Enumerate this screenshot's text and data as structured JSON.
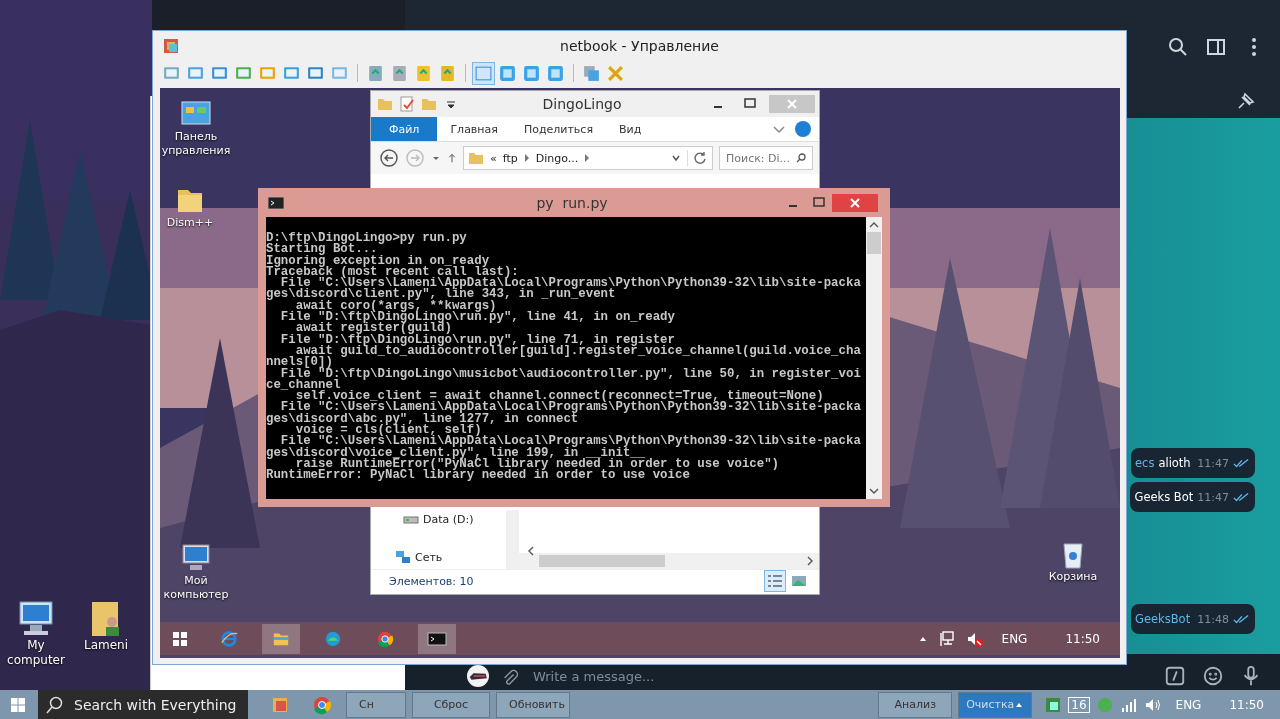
{
  "host_desktop": {
    "icons": [
      {
        "label": "My computer",
        "kind": "computer"
      },
      {
        "label": "Lameni",
        "kind": "user-folder"
      }
    ]
  },
  "telegram": {
    "messages": [
      {
        "link": "ecs",
        "text": "alioth",
        "time": "11:47"
      },
      {
        "text": "Geeks Bot",
        "time": "11:47"
      },
      {
        "link": "GeeksBot",
        "time": "11:48"
      }
    ],
    "input": {
      "placeholder": "Write a message..."
    }
  },
  "vm_window": {
    "title": "netbook - Управление"
  },
  "guest": {
    "desktop_icons": [
      {
        "label": "Панель управления",
        "kind": "control-panel"
      },
      {
        "label": "Dism++",
        "kind": "folder"
      },
      {
        "label": "Мой компьютер",
        "kind": "computer"
      },
      {
        "label": "Корзина",
        "kind": "recycle-bin"
      }
    ],
    "explorer": {
      "title": "DingoLingo",
      "tabs": [
        {
          "label": "Файл",
          "selected": true
        },
        {
          "label": "Главная",
          "selected": false
        },
        {
          "label": "Поделиться",
          "selected": false
        },
        {
          "label": "Вид",
          "selected": false
        }
      ],
      "path": [
        "«",
        "ftp",
        "Dingo..."
      ],
      "search": {
        "placeholder": "Поиск: Di..."
      },
      "nav_items": [
        {
          "label": "Data (D:)",
          "kind": "drive"
        },
        {
          "label": "Сеть",
          "kind": "network"
        }
      ],
      "status": "Элементов: 10"
    },
    "console": {
      "title": "py  run.py",
      "lines": [
        "D:\\ftp\\DingoLingo>py run.py",
        "Starting Bot...",
        "Ignoring exception in on_ready",
        "Traceback (most recent call last):",
        "  File \"C:\\Users\\Lameni\\AppData\\Local\\Programs\\Python\\Python39-32\\lib\\site-packa",
        "ges\\discord\\client.py\", line 343, in _run_event",
        "    await coro(*args, **kwargs)",
        "  File \"D:\\ftp\\DingoLingo\\run.py\", line 41, in on_ready",
        "    await register(guild)",
        "  File \"D:\\ftp\\DingoLingo\\run.py\", line 71, in register",
        "    await guild_to_audiocontroller[guild].register_voice_channel(guild.voice_cha",
        "nnels[0])",
        "  File \"D:\\ftp\\DingoLingo\\musicbot\\audiocontroller.py\", line 50, in register_voi",
        "ce_channel",
        "    self.voice_client = await channel.connect(reconnect=True, timeout=None)",
        "  File \"C:\\Users\\Lameni\\AppData\\Local\\Programs\\Python\\Python39-32\\lib\\site-packa",
        "ges\\discord\\abc.py\", line 1277, in connect",
        "    voice = cls(client, self)",
        "  File \"C:\\Users\\Lameni\\AppData\\Local\\Programs\\Python\\Python39-32\\lib\\site-packa",
        "ges\\discord\\voice_client.py\", line 199, in __init__",
        "    raise RuntimeError(\"PyNaCl library needed in order to use voice\")",
        "RuntimeError: PyNaCl library needed in order to use voice"
      ]
    },
    "taskbar": {
      "apps": [
        {
          "kind": "ie",
          "selected": false
        },
        {
          "kind": "explorer",
          "selected": true
        },
        {
          "kind": "edge",
          "selected": false
        },
        {
          "kind": "chrome",
          "selected": false
        },
        {
          "kind": "console",
          "selected": true
        }
      ],
      "language": "ENG",
      "time": "11:50"
    }
  },
  "host_taskbar": {
    "search": "Search with Everything",
    "tool_buttons": [
      "Сн",
      "Сброс",
      "Обновить"
    ],
    "action_buttons": [
      {
        "label": "Анализ",
        "kind": "plain"
      },
      {
        "label": "Очистка",
        "kind": "primary"
      }
    ],
    "badge": "16",
    "language": "ENG",
    "time": "11:50"
  }
}
